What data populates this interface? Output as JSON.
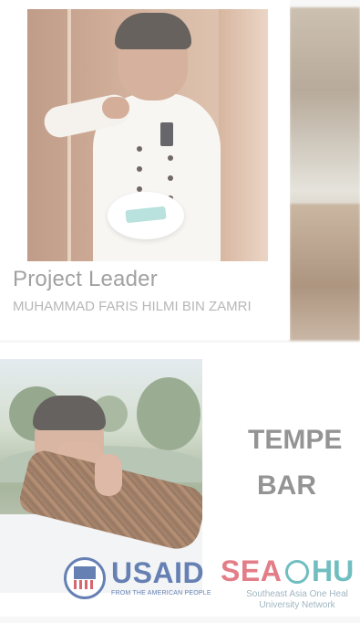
{
  "top_card": {
    "role": "Project Leader",
    "name": "MUHAMMAD FARIS HILMI BIN ZAMRI"
  },
  "product": {
    "line1": "TEMPE",
    "line2": "BAR"
  },
  "logos": {
    "usaid": "USAID",
    "usaid_tagline": "FROM THE AMERICAN PEOPLE",
    "seaohun_left": "SEA",
    "seaohun_right": "HU",
    "seaohun_line1": "Southeast Asia One Heal",
    "seaohun_line2": "University Network"
  },
  "colors": {
    "usaid_blue": "#2b4f98",
    "sea_red": "#d94b59",
    "hun_teal": "#3aa6a8"
  }
}
